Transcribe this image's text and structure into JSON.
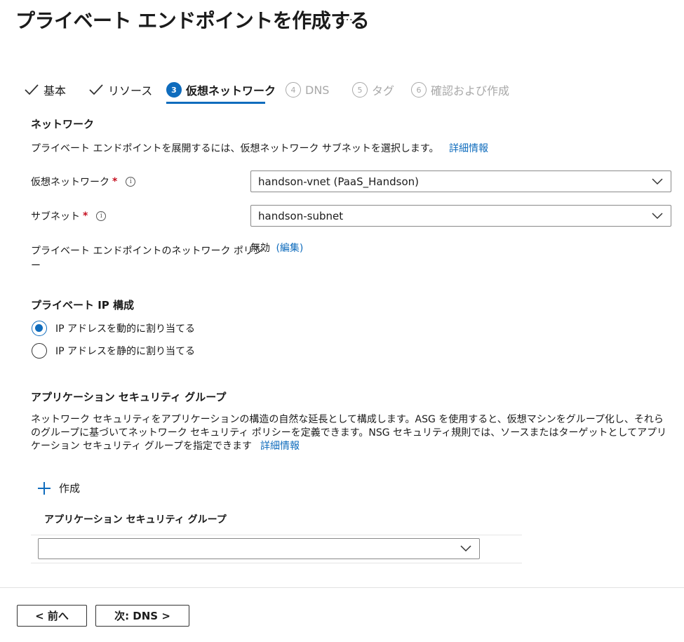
{
  "header": {
    "title": "プライベート エンドポイントを作成する",
    "more": "…"
  },
  "tabs": [
    {
      "number": "",
      "label": "基本",
      "state": "done"
    },
    {
      "number": "",
      "label": "リソース",
      "state": "done"
    },
    {
      "number": "3",
      "label": "仮想ネットワーク",
      "state": "active"
    },
    {
      "number": "4",
      "label": "DNS",
      "state": "disabled"
    },
    {
      "number": "5",
      "label": "タグ",
      "state": "disabled"
    },
    {
      "number": "6",
      "label": "確認および作成",
      "state": "disabled"
    }
  ],
  "network": {
    "section_title": "ネットワーク",
    "description": "プライベート エンドポイントを展開するには、仮想ネットワーク サブネットを選択します。",
    "learn_more": "詳細情報",
    "vnet_label": "仮想ネットワーク",
    "vnet_value": "handson-vnet (PaaS_Handson)",
    "subnet_label": "サブネット",
    "subnet_value": "handson-subnet",
    "required_mark": "*",
    "info_glyph": "i",
    "policy_label_line1": "プライベート エンドポイントのネットワーク ポリシ",
    "policy_label_line2": "ー",
    "policy_value": "無効",
    "policy_edit": "(編集)"
  },
  "ip_config": {
    "section_title": "プライベート IP 構成",
    "options": [
      {
        "label": "IP アドレスを動的に割り当てる",
        "checked": true
      },
      {
        "label": "IP アドレスを静的に割り当てる",
        "checked": false
      }
    ]
  },
  "asg": {
    "section_title": "アプリケーション セキュリティ グループ",
    "description": "ネットワーク セキュリティをアプリケーションの構造の自然な延長として構成します。ASG を使用すると、仮想マシンをグループ化し、それらのグループに基づいてネットワーク セキュリティ ポリシーを定義できます。NSG セキュリティ規則では、ソースまたはターゲットとしてアプリケーション セキュリティ グループを指定できます",
    "learn_more": "詳細情報",
    "create_label": "作成",
    "column_header": "アプリケーション セキュリティ グループ",
    "select_value": ""
  },
  "footer": {
    "prev_label": "< 前へ",
    "next_label": "次: DNS >"
  },
  "colors": {
    "accent": "#0f6cbd",
    "required": "#c50f1f",
    "disabled": "#a8a8a8"
  }
}
